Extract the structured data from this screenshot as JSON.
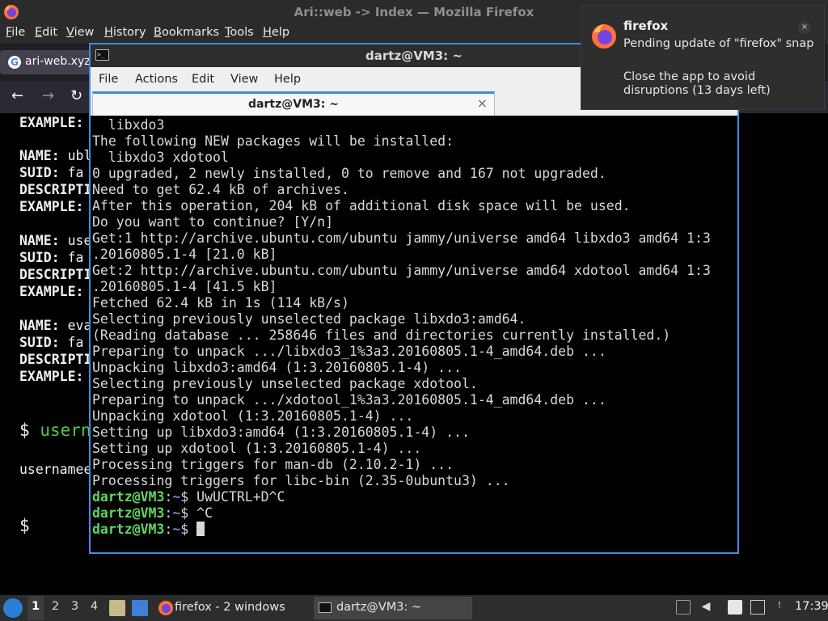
{
  "firefox": {
    "window_title": "Ari::web -> Index — Mozilla Firefox",
    "menu": [
      "File",
      "Edit",
      "View",
      "History",
      "Bookmarks",
      "Tools",
      "Help"
    ],
    "tab_label": "ari-web.xyz",
    "bg_lines": [
      {
        "label": "EXAMPLE:",
        "value": ""
      },
      {
        "label": "NAME:",
        "value": " ubl"
      },
      {
        "label": "SUID:",
        "value": " fa"
      },
      {
        "label": "DESCRIPTI",
        "value": ""
      },
      {
        "label": "EXAMPLE:",
        "value": ""
      },
      {
        "label": "NAME:",
        "value": " use"
      },
      {
        "label": "SUID:",
        "value": " fa"
      },
      {
        "label": "DESCRIPTI",
        "value": ""
      },
      {
        "label": "EXAMPLE:",
        "value": ""
      },
      {
        "label": "NAME:",
        "value": " eva"
      },
      {
        "label": "SUID:",
        "value": " fa"
      },
      {
        "label": "DESCRIPTI",
        "value": ""
      },
      {
        "label": "EXAMPLE:",
        "value": ""
      }
    ],
    "prompt_symbol": "$",
    "prompt_cmd": "usern",
    "output_text": "usernamee",
    "prompt_symbol2": "$"
  },
  "terminal": {
    "title": "dartz@VM3: ~",
    "menu": [
      "File",
      "Actions",
      "Edit",
      "View",
      "Help"
    ],
    "tab_label": "dartz@VM3: ~",
    "tab_close": "×",
    "icon_text": ">_",
    "lines": [
      "  libxdo3",
      "The following NEW packages will be installed:",
      "  libxdo3 xdotool",
      "0 upgraded, 2 newly installed, 0 to remove and 167 not upgraded.",
      "Need to get 62.4 kB of archives.",
      "After this operation, 204 kB of additional disk space will be used.",
      "Do you want to continue? [Y/n]",
      "Get:1 http://archive.ubuntu.com/ubuntu jammy/universe amd64 libxdo3 amd64 1:3",
      ".20160805.1-4 [21.0 kB]",
      "Get:2 http://archive.ubuntu.com/ubuntu jammy/universe amd64 xdotool amd64 1:3",
      ".20160805.1-4 [41.5 kB]",
      "Fetched 62.4 kB in 1s (114 kB/s)",
      "Selecting previously unselected package libxdo3:amd64.",
      "(Reading database ... 258646 files and directories currently installed.)",
      "Preparing to unpack .../libxdo3_1%3a3.20160805.1-4_amd64.deb ...",
      "Unpacking libxdo3:amd64 (1:3.20160805.1-4) ...",
      "Selecting previously unselected package xdotool.",
      "Preparing to unpack .../xdotool_1%3a3.20160805.1-4_amd64.deb ...",
      "Unpacking xdotool (1:3.20160805.1-4) ...",
      "Setting up libxdo3:amd64 (1:3.20160805.1-4) ...",
      "Setting up xdotool (1:3.20160805.1-4) ...",
      "Processing triggers for man-db (2.10.2-1) ...",
      "Processing triggers for libc-bin (2.35-0ubuntu3) ..."
    ],
    "prompts": [
      {
        "user": "dartz@VM3",
        "sep": ":",
        "path": "~",
        "dollar": "$ ",
        "cmd": "UwUCTRL+D^C"
      },
      {
        "user": "dartz@VM3",
        "sep": ":",
        "path": "~",
        "dollar": "$ ",
        "cmd": "^C"
      },
      {
        "user": "dartz@VM3",
        "sep": ":",
        "path": "~",
        "dollar": "$ ",
        "cmd": ""
      }
    ]
  },
  "notification": {
    "app": "firefox",
    "body1": "Pending update of \"firefox\" snap",
    "body2": "Close the app to avoid disruptions (13 days left)",
    "close": "×"
  },
  "taskbar": {
    "workspaces": [
      "1",
      "2",
      "3",
      "4"
    ],
    "tasks": [
      {
        "label": "firefox - 2 windows"
      },
      {
        "label": "dartz@VM3: ~"
      }
    ],
    "clock": "17:39"
  }
}
